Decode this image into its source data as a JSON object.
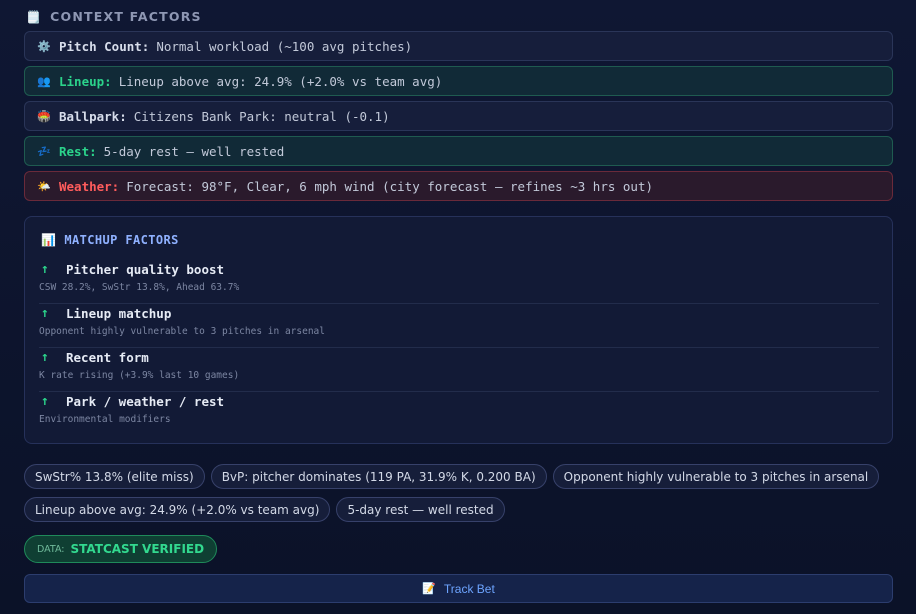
{
  "context": {
    "title": "CONTEXT FACTORS",
    "icon": "🗒️",
    "icon_name": "clipboard-icon",
    "rows": [
      {
        "icon": "⚙️",
        "icon_name": "gear-icon",
        "label": "Pitch Count:",
        "value": "Normal workload (~100 avg pitches)",
        "tone": "neutral"
      },
      {
        "icon": "👥",
        "icon_name": "people-icon",
        "label": "Lineup:",
        "value": "Lineup above avg: 24.9% (+2.0% vs team avg)",
        "tone": "green"
      },
      {
        "icon": "🏟️",
        "icon_name": "stadium-icon",
        "label": "Ballpark:",
        "value": "Citizens Bank Park: neutral (-0.1)",
        "tone": "neutral"
      },
      {
        "icon": "💤",
        "icon_name": "zzz-icon",
        "label": "Rest:",
        "value": "5-day rest — well rested",
        "tone": "green"
      },
      {
        "icon": "🌤️",
        "icon_name": "sun-cloud-icon",
        "label": "Weather:",
        "value": "Forecast: 98°F, Clear, 6 mph wind (city forecast — refines ~3 hrs out)",
        "tone": "red"
      }
    ]
  },
  "matchup": {
    "title": "MATCHUP FACTORS",
    "icon": "📊",
    "icon_name": "bar-chart-icon",
    "items": [
      {
        "arrow": "↑",
        "name": "Pitcher quality boost",
        "desc": "CSW 28.2%, SwStr 13.8%, Ahead 63.7%"
      },
      {
        "arrow": "↑",
        "name": "Lineup matchup",
        "desc": "Opponent highly vulnerable to 3 pitches in arsenal"
      },
      {
        "arrow": "↑",
        "name": "Recent form",
        "desc": "K rate rising (+3.9% last 10 games)"
      },
      {
        "arrow": "↑",
        "name": "Park / weather / rest",
        "desc": "Environmental modifiers"
      }
    ]
  },
  "tags": {
    "row1": [
      "SwStr% 13.8% (elite miss)",
      "BvP: pitcher dominates (119 PA, 31.9% K, 0.200 BA)",
      "Opponent highly vulnerable to 3 pitches in arsenal"
    ],
    "row2": [
      "Lineup above avg: 24.9% (+2.0% vs team avg)",
      "5-day rest — well rested"
    ]
  },
  "data_badge": {
    "key": "DATA:",
    "value": "STATCAST VERIFIED"
  },
  "track_button": {
    "icon": "📝",
    "icon_name": "memo-icon",
    "label": "Track Bet"
  },
  "colors": {
    "background": "#0d1430",
    "positive": "#2bd38b",
    "negative": "#ff5c5c",
    "accent": "#6da4ff"
  }
}
